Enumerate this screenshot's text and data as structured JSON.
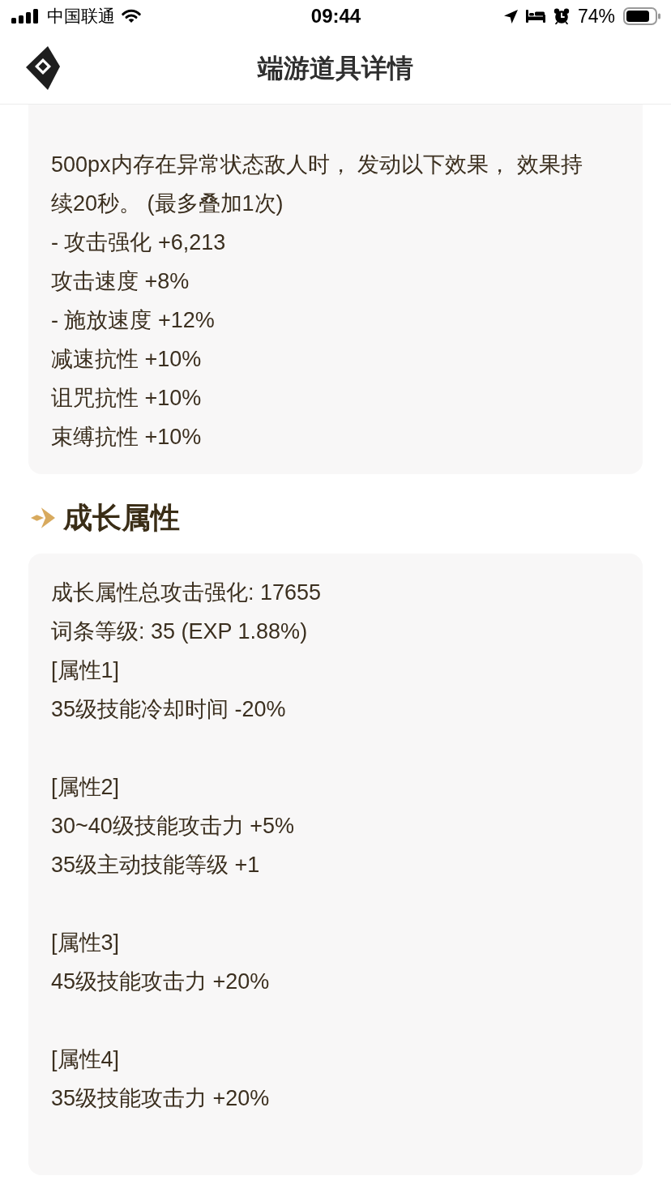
{
  "status_bar": {
    "carrier": "中国联通",
    "time": "09:44",
    "battery": "74%"
  },
  "header": {
    "title": "端游道具详情"
  },
  "effect_card": {
    "description": "500px内存在异常状态敌人时， 发动以下效果， 效果持续20秒。 (最多叠加1次)",
    "lines": [
      "- 攻击强化 +6,213",
      "攻击速度 +8%",
      "- 施放速度 +12%",
      "减速抗性 +10%",
      "诅咒抗性 +10%",
      "束缚抗性 +10%"
    ]
  },
  "growth_section": {
    "title": "成长属性",
    "summary": [
      "成长属性总攻击强化: 17655",
      "词条等级: 35 (EXP 1.88%)"
    ],
    "attributes": [
      {
        "label": "[属性1]",
        "effects": [
          "35级技能冷却时间 -20%"
        ]
      },
      {
        "label": "[属性2]",
        "effects": [
          "30~40级技能攻击力 +5%",
          "35级主动技能等级 +1"
        ]
      },
      {
        "label": "[属性3]",
        "effects": [
          "45级技能攻击力 +20%"
        ]
      },
      {
        "label": "[属性4]",
        "effects": [
          "35级技能攻击力 +20%"
        ]
      }
    ]
  }
}
